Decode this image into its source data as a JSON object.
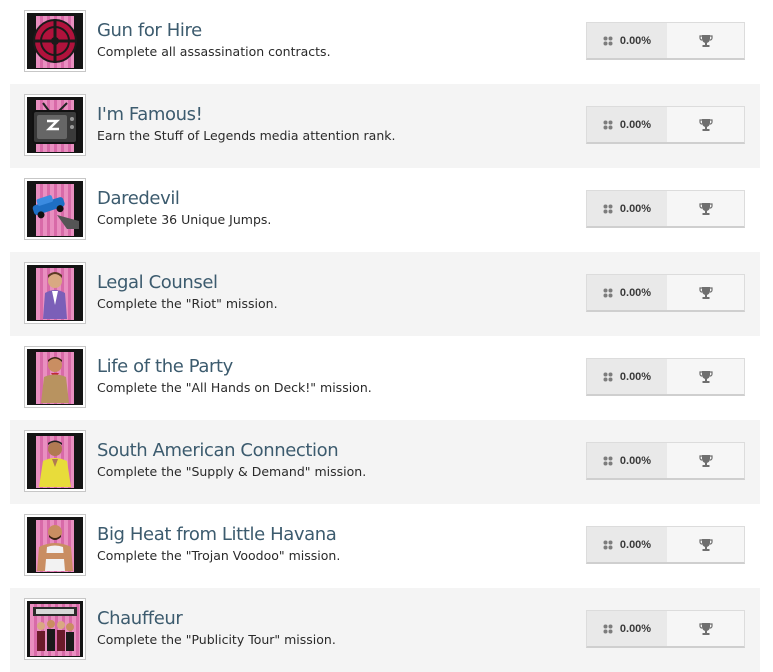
{
  "achievements": [
    {
      "title": "Gun for Hire",
      "description": "Complete all assassination contracts.",
      "percent": "0.00%",
      "icon": "crosshair-icon"
    },
    {
      "title": "I'm Famous!",
      "description": "Earn the Stuff of Legends media attention rank.",
      "percent": "0.00%",
      "icon": "television-icon"
    },
    {
      "title": "Daredevil",
      "description": "Complete 36 Unique Jumps.",
      "percent": "0.00%",
      "icon": "jumping-car-icon"
    },
    {
      "title": "Legal Counsel",
      "description": "Complete the \"Riot\" mission.",
      "percent": "0.00%",
      "icon": "lawyer-portrait-icon"
    },
    {
      "title": "Life of the Party",
      "description": "Complete the \"All Hands on Deck!\" mission.",
      "percent": "0.00%",
      "icon": "party-guy-portrait-icon"
    },
    {
      "title": "South American Connection",
      "description": "Complete the \"Supply & Demand\" mission.",
      "percent": "0.00%",
      "icon": "yellow-shirt-portrait-icon"
    },
    {
      "title": "Big Heat from Little Havana",
      "description": "Complete the \"Trojan Voodoo\" mission.",
      "percent": "0.00%",
      "icon": "tank-top-portrait-icon"
    },
    {
      "title": "Chauffeur",
      "description": "Complete the \"Publicity Tour\" mission.",
      "percent": "0.00%",
      "icon": "love-fist-band-icon"
    }
  ],
  "colors": {
    "title": "#3c5b6e",
    "row_alt_background": "#f4f4f4",
    "icon_pink": "#e98fc0"
  }
}
